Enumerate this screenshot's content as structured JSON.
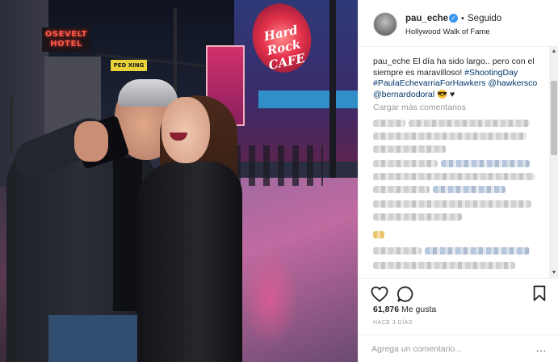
{
  "photo": {
    "hotel_sign": "OSEVELT HOTEL",
    "street_sign": "PED XING",
    "cafe_sign": "Hard Rock CAFE"
  },
  "post": {
    "username": "pau_eche",
    "verified_icon": "verified-check-icon",
    "separator": "•",
    "follow_status": "Seguido",
    "location": "Hollywood Walk of Fame",
    "caption": {
      "username": "pau_eche",
      "text": "El día ha sido largo.. pero con el siempre es maravilloso!",
      "hashtags": "#ShootingDay #PaulaEchevarriaForHawkers",
      "mentions": "@hawkersco @bernardodoral",
      "emoji": "😎 ♥"
    },
    "load_more": "Cargar más comentarios",
    "likes_count": "61,876",
    "likes_label": "Me gusta",
    "timestamp": "HACE 3 DÍAS",
    "comment_placeholder": "Agrega un comentario...",
    "more_options": "..."
  },
  "icons": {
    "like": "heart-icon",
    "comment": "comment-icon",
    "save": "bookmark-icon"
  },
  "colors": {
    "link": "#003569",
    "verified": "#3897f0",
    "muted": "#999999",
    "text": "#262626"
  }
}
